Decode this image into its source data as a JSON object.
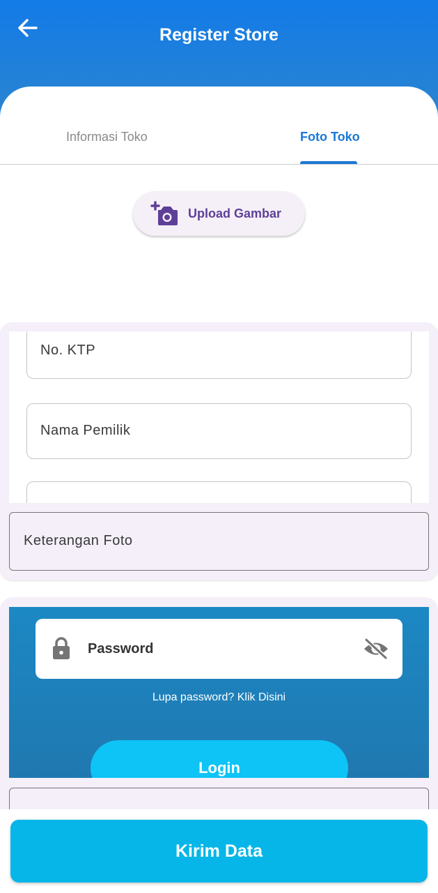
{
  "header": {
    "back_icon": "arrow-left-icon",
    "title": "Register Store"
  },
  "tabs": [
    {
      "label": "Informasi Toko",
      "selected": false
    },
    {
      "label": "Foto Toko",
      "selected": true
    }
  ],
  "upload": {
    "icon": "add-photo-icon",
    "label": "Upload Gambar"
  },
  "form": {
    "ktp_label": "No. KTP",
    "nama_label": "Nama Pemilik",
    "keterangan_label": "Keterangan Foto"
  },
  "login_preview": {
    "password_label": "Password",
    "lock_icon": "lock-icon",
    "eye_icon": "eye-off-icon",
    "forgot_text": "Lupa password? Klik Disini",
    "login_label": "Login"
  },
  "submit": {
    "label": "Kirim Data"
  },
  "colors": {
    "header_top": "#137be8",
    "header_bottom": "#2a84cf",
    "active_tab": "#1a78d4",
    "upload_text": "#5e3f97",
    "submit_bg": "#06b6e8",
    "panel_bg": "#f4eff8"
  }
}
